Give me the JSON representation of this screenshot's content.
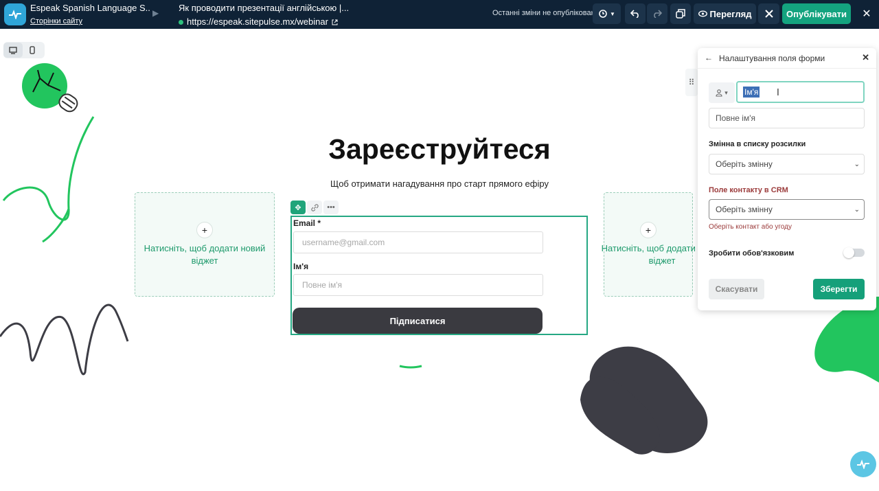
{
  "topbar": {
    "site_name": "Espeak Spanish Language S...",
    "site_pages_link": "Сторінки сайту",
    "page_title": "Як проводити презентації англійською |...",
    "page_url": "https://espeak.sitepulse.mx/webinar",
    "status": "Останні зміни не опубліковано",
    "preview_label": "Перегляд",
    "publish_label": "Опублікувати"
  },
  "canvas": {
    "headline": "Зареєструйтеся",
    "subheadline": "Щоб отримати нагадування про старт прямого ефіру",
    "widget_placeholder_left": "Натисніть, щоб додати новий віджет",
    "widget_placeholder_right": "Натисніть, щоб додати новий віджет",
    "form": {
      "email_label": "Email *",
      "email_placeholder": "username@gmail.com",
      "name_label": "Ім'я",
      "name_placeholder": "Повне ім'я",
      "submit_label": "Підписатися"
    }
  },
  "panel": {
    "title": "Налаштування поля форми",
    "field_label_value": "Ім'я",
    "placeholder_value": "Повне ім'я",
    "mailing_var_label": "Змінна в списку розсилки",
    "mailing_var_select": "Оберіть змінну",
    "crm_label": "Поле контакту в CRM",
    "crm_select": "Оберіть змінну",
    "crm_hint": "Оберіть контакт або угоду",
    "required_label": "Зробити обов'язковим",
    "required_on": false,
    "cancel_label": "Скасувати",
    "save_label": "Зберегти"
  },
  "colors": {
    "topbar_bg": "#0f2236",
    "accent_green": "#14a37f",
    "widget_border": "#25a883",
    "crm_red": "#9b3b3b"
  },
  "icons": [
    "app-logo-icon",
    "history-icon",
    "undo-icon",
    "redo-icon",
    "copy-icon",
    "eye-icon",
    "tools-icon",
    "close-icon",
    "desktop-icon",
    "mobile-icon",
    "move-icon",
    "link-icon",
    "more-icon",
    "drag-icon",
    "back-arrow-icon",
    "person-icon",
    "chevron-down-icon",
    "help-bubble-icon"
  ]
}
